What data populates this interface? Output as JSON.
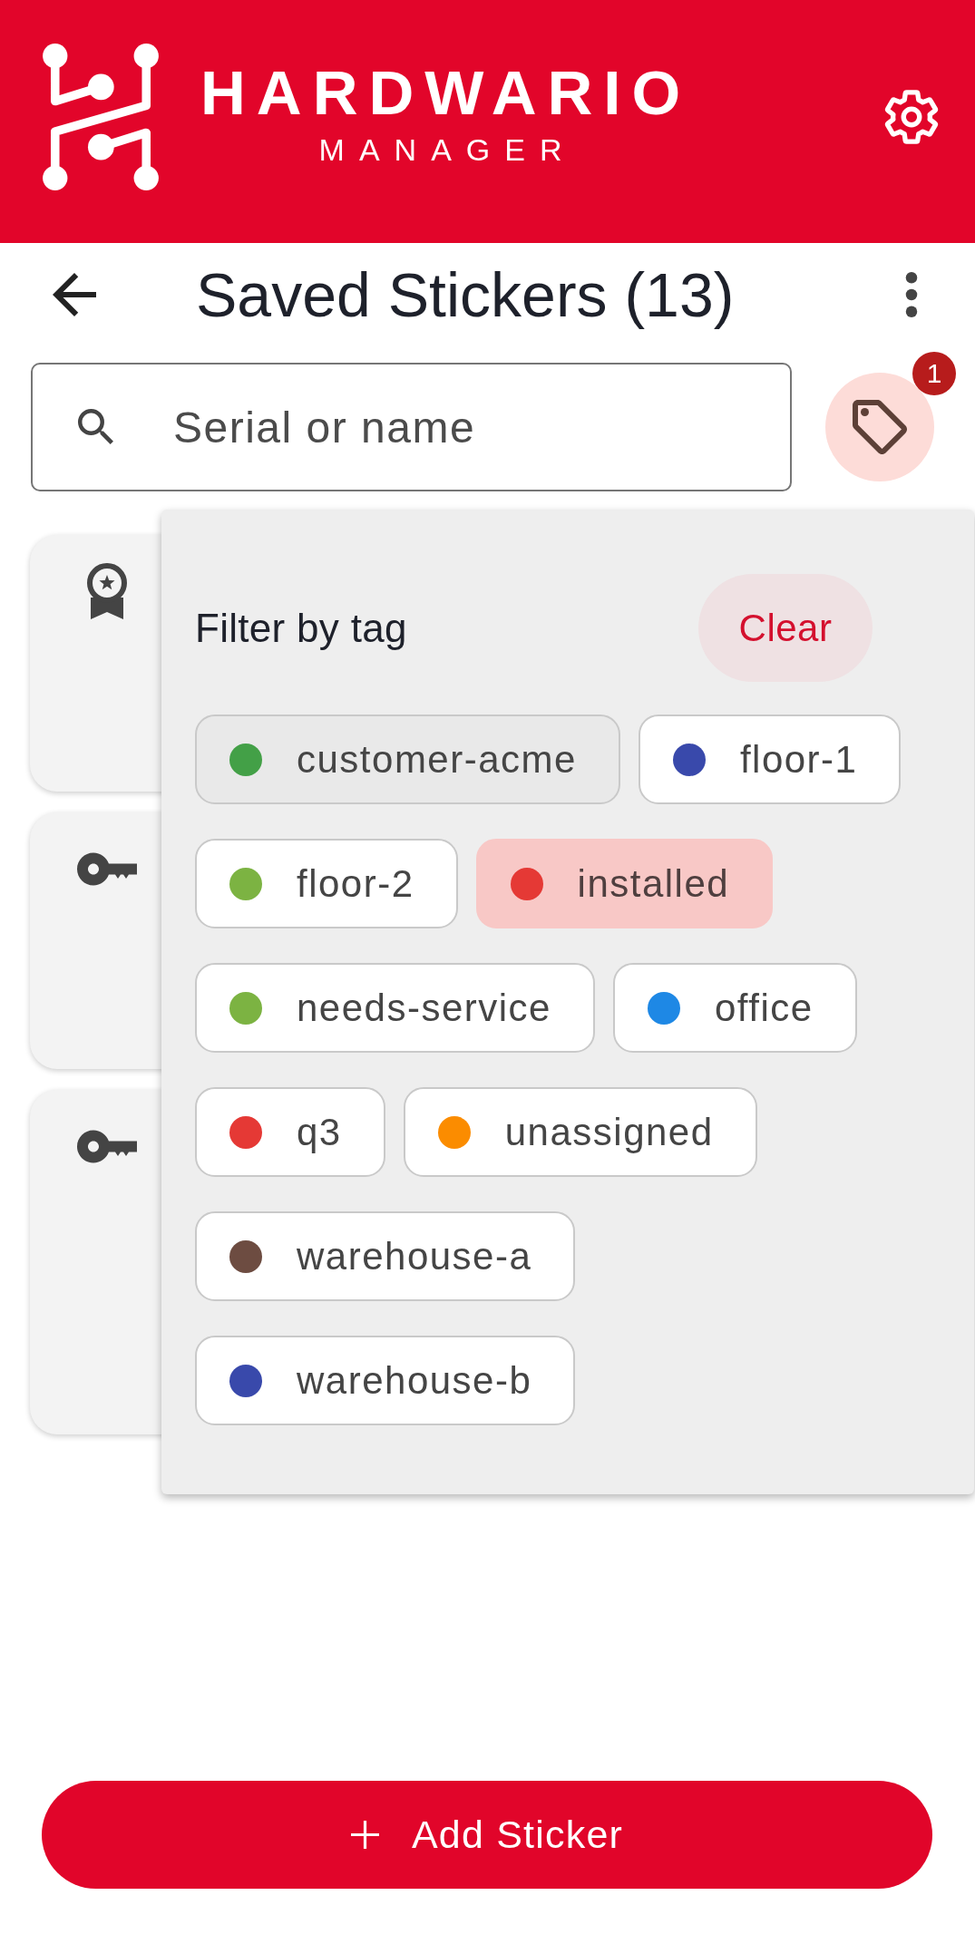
{
  "header": {
    "brand": "HARDWARIO",
    "subtitle": "MANAGER"
  },
  "toolbar": {
    "title": "Saved Stickers (13)"
  },
  "search": {
    "placeholder": "Serial or name"
  },
  "tag_filter_button": {
    "active": true,
    "badge": "1"
  },
  "cards": [
    {
      "kind": "award"
    },
    {
      "kind": "key"
    },
    {
      "kind": "key"
    }
  ],
  "tag_filter_popup": {
    "title": "Filter by tag",
    "clear_label": "Clear",
    "tags": [
      {
        "label": "customer-acme",
        "color": "#43a047",
        "selected": false,
        "focused": true
      },
      {
        "label": "floor-1",
        "color": "#3949ab",
        "selected": false,
        "focused": false
      },
      {
        "label": "floor-2",
        "color": "#7cb342",
        "selected": false,
        "focused": false
      },
      {
        "label": "installed",
        "color": "#e53935",
        "selected": true,
        "focused": false
      },
      {
        "label": "needs-service",
        "color": "#7cb342",
        "selected": false,
        "focused": false
      },
      {
        "label": "office",
        "color": "#1e88e5",
        "selected": false,
        "focused": false
      },
      {
        "label": "q3",
        "color": "#e53935",
        "selected": false,
        "focused": false
      },
      {
        "label": "unassigned",
        "color": "#fb8c00",
        "selected": false,
        "focused": false
      },
      {
        "label": "warehouse-a",
        "color": "#6d4c41",
        "selected": false,
        "focused": false
      },
      {
        "label": "warehouse-b",
        "color": "#3949ab",
        "selected": false,
        "focused": false
      }
    ]
  },
  "add_button": {
    "label": "Add Sticker"
  }
}
